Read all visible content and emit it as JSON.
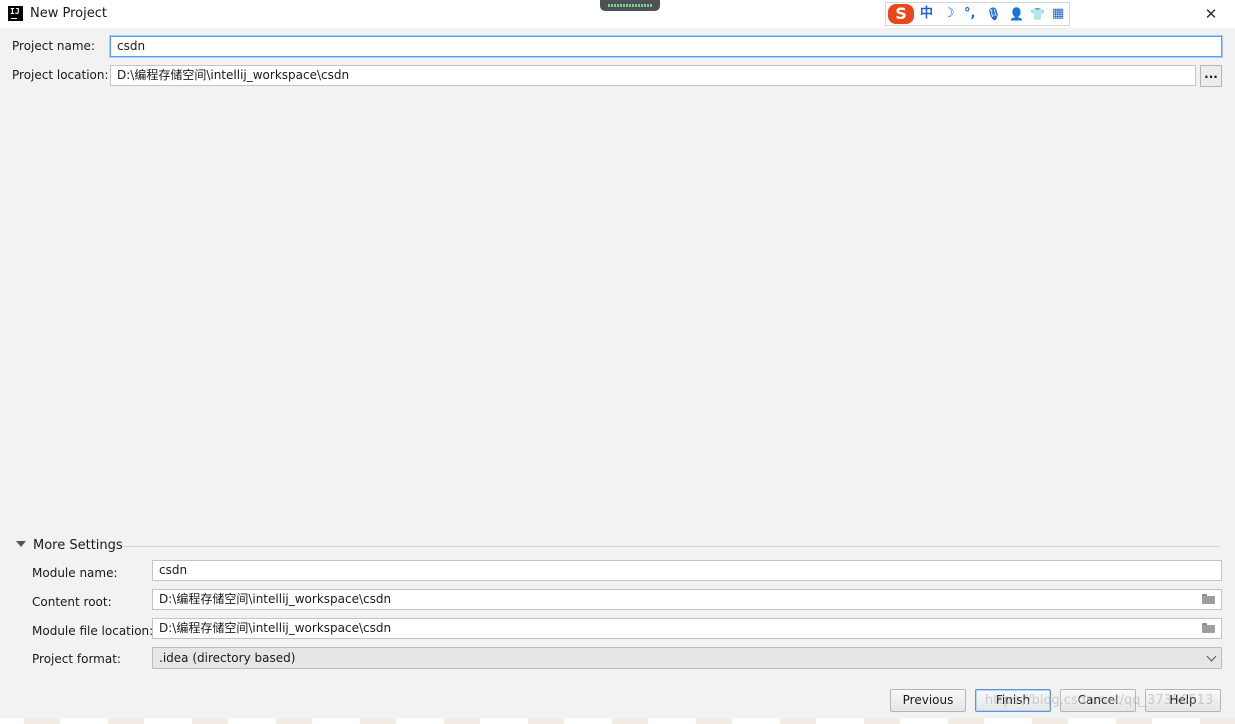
{
  "window": {
    "title": "New Project",
    "logo_text": "IJ",
    "close_glyph": "✕"
  },
  "ime": {
    "logo": "S",
    "items": [
      {
        "name": "chinese-mode-indicator",
        "text": "中"
      },
      {
        "name": "moon-icon",
        "text": "☽"
      },
      {
        "name": "punctuation-icon",
        "text": "°,"
      },
      {
        "name": "microphone-icon",
        "text": "🎙"
      },
      {
        "name": "user-icon",
        "text": "👤"
      },
      {
        "name": "skin-shirt-icon",
        "text": "👕"
      },
      {
        "name": "toolbox-grid-icon",
        "text": "▦"
      }
    ]
  },
  "form": {
    "project_name_label": "Project name:",
    "project_name_value": "csdn",
    "project_location_label": "Project location:",
    "project_location_value": "D:\\编程存储空间\\intellij_workspace\\csdn",
    "browse_label": "..."
  },
  "more_settings": {
    "title": "More Settings",
    "module_name_label": "Module name:",
    "module_name_value": "csdn",
    "content_root_label": "Content root:",
    "content_root_value": "D:\\编程存储空间\\intellij_workspace\\csdn",
    "module_file_location_label": "Module file location:",
    "module_file_location_value": "D:\\编程存储空间\\intellij_workspace\\csdn",
    "project_format_label": "Project format:",
    "project_format_value": ".idea (directory based)"
  },
  "buttons": {
    "previous": "Previous",
    "finish": "Finish",
    "cancel": "Cancel",
    "help": "Help"
  },
  "watermark": "https://blog.csdn.net/qq_37356513"
}
